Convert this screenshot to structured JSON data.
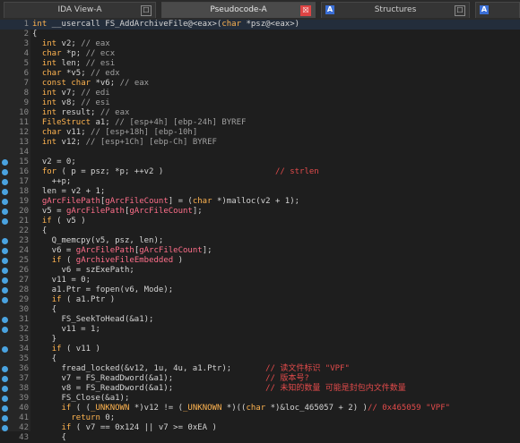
{
  "tabs": [
    {
      "label": "IDA View-A",
      "close": "☐",
      "icon": ""
    },
    {
      "label": "Pseudocode-A",
      "close": "☒",
      "icon": ""
    },
    {
      "label": "Structures",
      "close": "☐",
      "icon": "A"
    }
  ],
  "code": [
    {
      "n": "1",
      "bp": false,
      "t": "int __usercall FS_AddArchiveFile@<eax>(char *psz@<eax>)"
    },
    {
      "n": "2",
      "bp": false,
      "t": "{"
    },
    {
      "n": "3",
      "bp": false,
      "t": "  int v2; // eax"
    },
    {
      "n": "4",
      "bp": false,
      "t": "  char *p; // ecx"
    },
    {
      "n": "5",
      "bp": false,
      "t": "  int len; // esi"
    },
    {
      "n": "6",
      "bp": false,
      "t": "  char *v5; // edx"
    },
    {
      "n": "7",
      "bp": false,
      "t": "  const char *v6; // eax"
    },
    {
      "n": "8",
      "bp": false,
      "t": "  int v7; // edi"
    },
    {
      "n": "9",
      "bp": false,
      "t": "  int v8; // esi"
    },
    {
      "n": "10",
      "bp": false,
      "t": "  int result; // eax"
    },
    {
      "n": "11",
      "bp": false,
      "t": "  FileStruct a1; // [esp+4h] [ebp-24h] BYREF"
    },
    {
      "n": "12",
      "bp": false,
      "t": "  char v11; // [esp+18h] [ebp-10h]"
    },
    {
      "n": "13",
      "bp": false,
      "t": "  int v12; // [esp+1Ch] [ebp-Ch] BYREF"
    },
    {
      "n": "14",
      "bp": false,
      "t": ""
    },
    {
      "n": "15",
      "bp": true,
      "t": "  v2 = 0;"
    },
    {
      "n": "16",
      "bp": true,
      "t": "  for ( p = psz; *p; ++v2 )                       // strlen"
    },
    {
      "n": "17",
      "bp": true,
      "t": "    ++p;"
    },
    {
      "n": "18",
      "bp": true,
      "t": "  len = v2 + 1;"
    },
    {
      "n": "19",
      "bp": true,
      "t": "  gArcFilePath[gArcFileCount] = (char *)malloc(v2 + 1);"
    },
    {
      "n": "20",
      "bp": true,
      "t": "  v5 = gArcFilePath[gArcFileCount];"
    },
    {
      "n": "21",
      "bp": true,
      "t": "  if ( v5 )"
    },
    {
      "n": "22",
      "bp": false,
      "t": "  {"
    },
    {
      "n": "23",
      "bp": true,
      "t": "    Q_memcpy(v5, psz, len);"
    },
    {
      "n": "24",
      "bp": true,
      "t": "    v6 = gArcFilePath[gArcFileCount];"
    },
    {
      "n": "25",
      "bp": true,
      "t": "    if ( gArchiveFileEmbedded )"
    },
    {
      "n": "26",
      "bp": true,
      "t": "      v6 = szExePath;"
    },
    {
      "n": "27",
      "bp": true,
      "t": "    v11 = 0;"
    },
    {
      "n": "28",
      "bp": true,
      "t": "    a1.Ptr = fopen(v6, Mode);"
    },
    {
      "n": "29",
      "bp": true,
      "t": "    if ( a1.Ptr )"
    },
    {
      "n": "30",
      "bp": false,
      "t": "    {"
    },
    {
      "n": "31",
      "bp": true,
      "t": "      FS_SeekToHead(&a1);"
    },
    {
      "n": "32",
      "bp": true,
      "t": "      v11 = 1;"
    },
    {
      "n": "33",
      "bp": false,
      "t": "    }"
    },
    {
      "n": "34",
      "bp": true,
      "t": "    if ( v11 )"
    },
    {
      "n": "35",
      "bp": false,
      "t": "    {"
    },
    {
      "n": "36",
      "bp": true,
      "t": "      fread_locked(&v12, 1u, 4u, a1.Ptr);       // 读文件标识 \"VPF\""
    },
    {
      "n": "37",
      "bp": true,
      "t": "      v7 = FS_ReadDword(&a1);                   // 版本号?"
    },
    {
      "n": "38",
      "bp": true,
      "t": "      v8 = FS_ReadDword(&a1);                   // 未知的数量 可能是封包内文件数量"
    },
    {
      "n": "39",
      "bp": true,
      "t": "      FS_Close(&a1);"
    },
    {
      "n": "40",
      "bp": true,
      "t": "      if ( (_UNKNOWN *)v12 != (_UNKNOWN *)((char *)&loc_465057 + 2) )// 0x465059 \"VPF\""
    },
    {
      "n": "41",
      "bp": true,
      "t": "        return 0;"
    },
    {
      "n": "42",
      "bp": true,
      "t": "      if ( v7 == 0x124 || v7 >= 0xEA )"
    },
    {
      "n": "43",
      "bp": false,
      "t": "      {"
    }
  ]
}
